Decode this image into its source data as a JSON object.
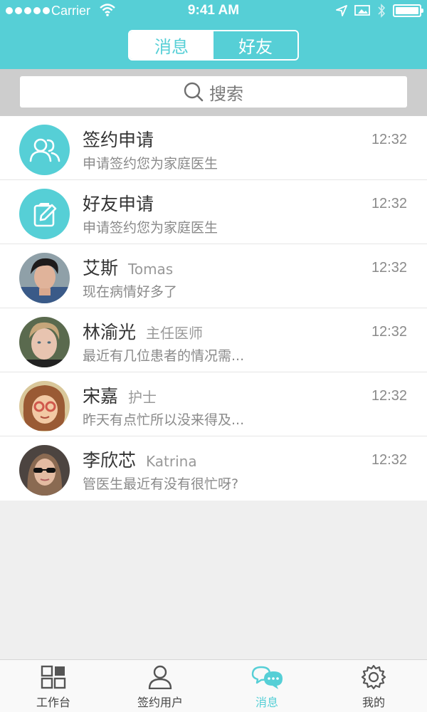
{
  "status_bar": {
    "carrier": "Carrier",
    "time": "9:41 AM"
  },
  "segment": {
    "tab1": "消息",
    "tab2": "好友",
    "active": "消息"
  },
  "search": {
    "placeholder": "搜索"
  },
  "conversations": [
    {
      "name": "签约申请",
      "sub": "",
      "message": "申请签约您为家庭医生",
      "time": "12:32",
      "avatar": "group-icon"
    },
    {
      "name": "好友申请",
      "sub": "",
      "message": "申请签约您为家庭医生",
      "time": "12:32",
      "avatar": "edit-icon"
    },
    {
      "name": "艾斯",
      "sub": "Tomas",
      "message": "现在病情好多了",
      "time": "12:32",
      "avatar": "photo"
    },
    {
      "name": "林渝光",
      "sub": "主任医师",
      "message": "最近有几位患者的情况需...",
      "time": "12:32",
      "avatar": "photo"
    },
    {
      "name": "宋嘉",
      "sub": "护士",
      "message": "昨天有点忙所以没来得及...",
      "time": "12:32",
      "avatar": "photo"
    },
    {
      "name": "李欣芯",
      "sub": "Katrina",
      "message": "管医生最近有没有很忙呀?",
      "time": "12:32",
      "avatar": "photo"
    }
  ],
  "tabbar": {
    "items": [
      {
        "label": "工作台",
        "icon": "grid-icon"
      },
      {
        "label": "签约用户",
        "icon": "user-icon"
      },
      {
        "label": "消息",
        "icon": "chat-icon"
      },
      {
        "label": "我的",
        "icon": "gear-icon"
      }
    ],
    "active": "消息"
  },
  "colors": {
    "accent": "#56cfd6",
    "tab_inactive": "#444444"
  }
}
